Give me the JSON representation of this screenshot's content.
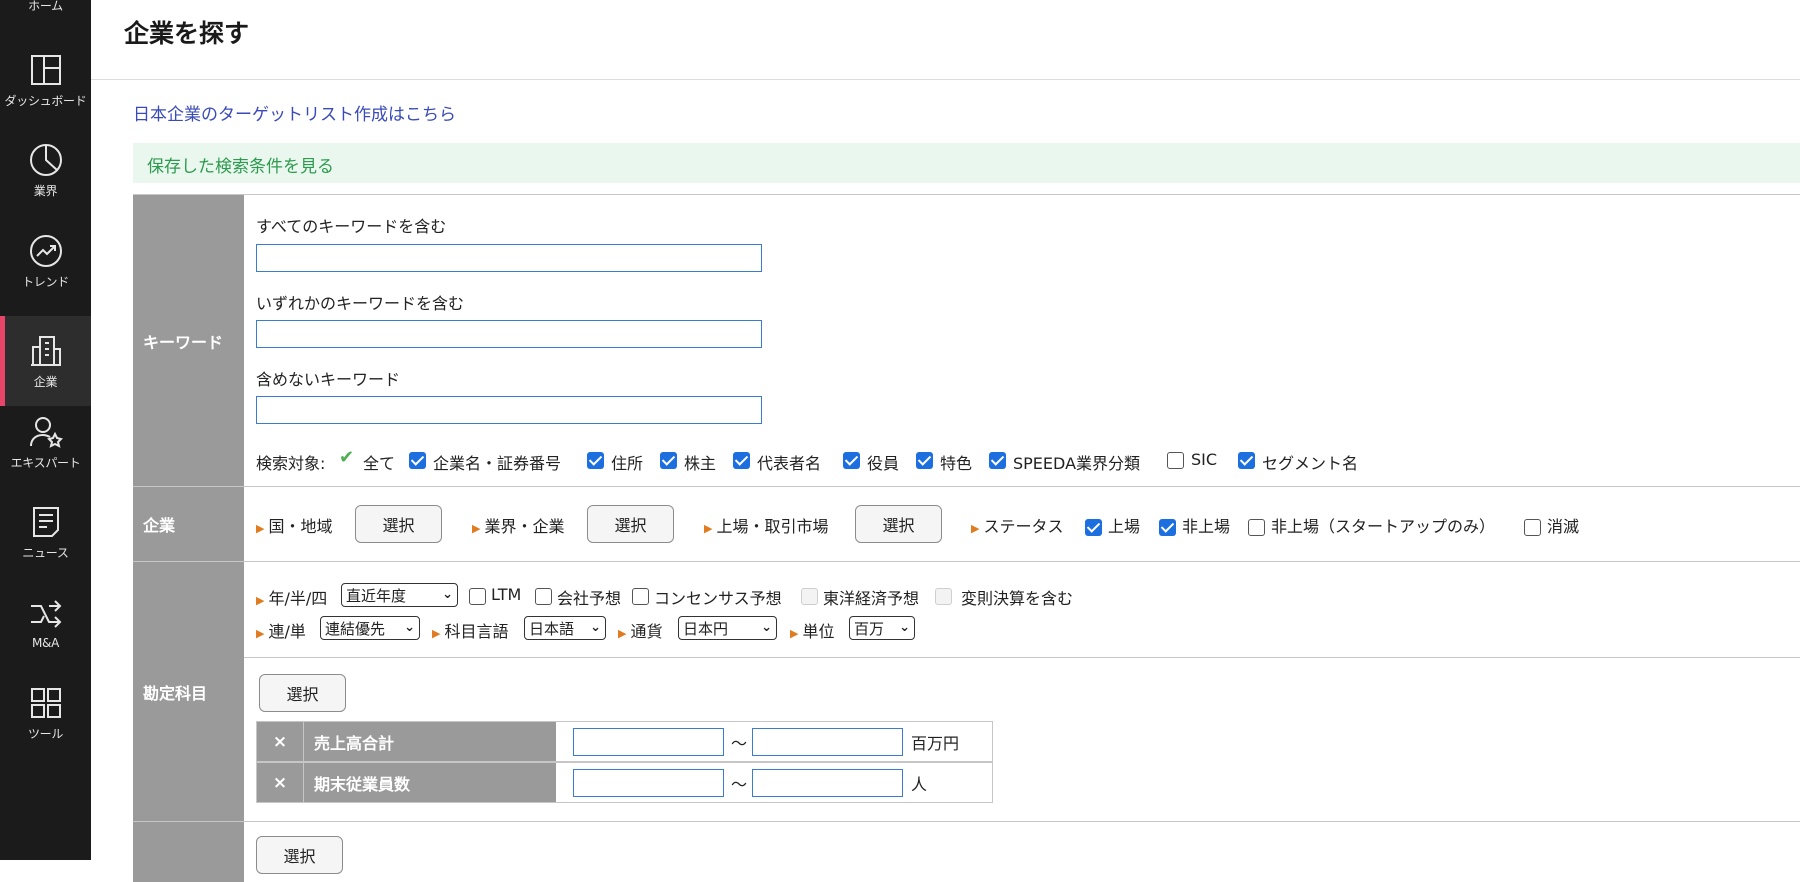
{
  "nav": [
    {
      "label": "ホーム",
      "icon": "home-icon"
    },
    {
      "label": "ダッシュボード",
      "icon": "dashboard-icon"
    },
    {
      "label": "業界",
      "icon": "pie-chart-icon"
    },
    {
      "label": "トレンド",
      "icon": "trend-icon"
    },
    {
      "label": "企業",
      "icon": "building-icon"
    },
    {
      "label": "エキスパート",
      "icon": "expert-icon"
    },
    {
      "label": "ニュース",
      "icon": "news-icon"
    },
    {
      "label": "M&A",
      "icon": "merge-icon"
    },
    {
      "label": "ツール",
      "icon": "grid-icon"
    }
  ],
  "page_title": "企業を探す",
  "jp_target_link": "日本企業のターゲットリスト作成はこちら",
  "saved_conditions_link": "保存した検索条件を見る",
  "keyword": {
    "label": "キーワード",
    "all_label": "すべてのキーワードを含む",
    "any_label": "いずれかのキーワードを含む",
    "exclude_label": "含めないキーワード",
    "search_target_label": "検索対象:",
    "targets": [
      {
        "label": "全て",
        "checked": true
      },
      {
        "label": "企業名・証券番号",
        "checked": true
      },
      {
        "label": "住所",
        "checked": true
      },
      {
        "label": "株主",
        "checked": true
      },
      {
        "label": "代表者名",
        "checked": true
      },
      {
        "label": "役員",
        "checked": true
      },
      {
        "label": "特色",
        "checked": true
      },
      {
        "label": "SPEEDA業界分類",
        "checked": true
      },
      {
        "label": "SIC",
        "checked": false
      },
      {
        "label": "セグメント名",
        "checked": true
      }
    ]
  },
  "company": {
    "label": "企業",
    "country_label": "国・地域",
    "industry_label": "業界・企業",
    "listing_label": "上場・取引市場",
    "status_label": "ステータス",
    "select_button": "選択",
    "statuses": [
      {
        "label": "上場",
        "checked": true
      },
      {
        "label": "非上場",
        "checked": true
      },
      {
        "label": "非上場（スタートアップのみ）",
        "checked": false
      },
      {
        "label": "消滅",
        "checked": false
      }
    ]
  },
  "accounts": {
    "label": "勘定科目",
    "period_label": "年/半/四",
    "period_value": "直近年度",
    "ltm_label": "LTM",
    "company_forecast_label": "会社予想",
    "consensus_label": "コンセンサス予想",
    "toyo_label": "東洋経済予想",
    "irregular_label": "変則決算を含む",
    "consol_label": "連/単",
    "consol_value": "連結優先",
    "lang_label": "科目言語",
    "lang_value": "日本語",
    "currency_label": "通貨",
    "currency_value": "日本円",
    "unit_label": "単位",
    "unit_value": "百万",
    "select_button": "選択",
    "remove_mark": "×",
    "range_sep": "〜",
    "items": [
      {
        "name": "売上高合計",
        "unit": "百万円"
      },
      {
        "name": "期末従業員数",
        "unit": "人"
      }
    ]
  },
  "next_select_button": "選択"
}
